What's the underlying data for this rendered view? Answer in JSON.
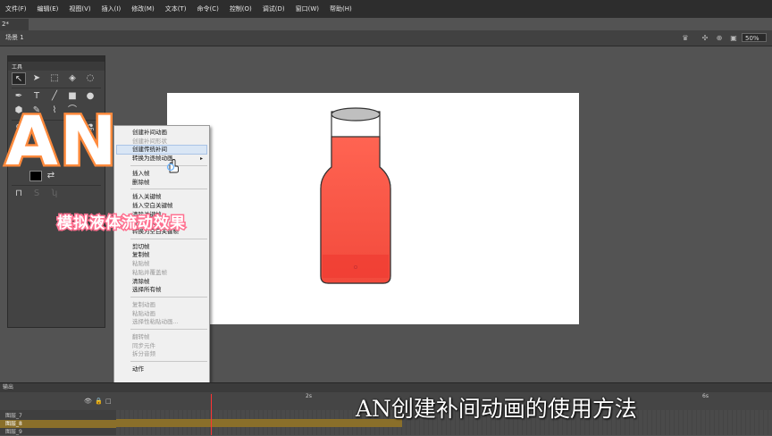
{
  "menubar": {
    "items": [
      "文件(F)",
      "编辑(E)",
      "视图(V)",
      "插入(I)",
      "修改(M)",
      "文本(T)",
      "命令(C)",
      "控制(O)",
      "调试(D)",
      "窗口(W)",
      "帮助(H)"
    ]
  },
  "document": {
    "tab_label": "2*"
  },
  "scene": {
    "label": "场景 1",
    "zoom": "50%"
  },
  "tools": {
    "title": "工具"
  },
  "context_menu": {
    "groups": [
      [
        {
          "label": "创建补间动画",
          "enabled": true
        },
        {
          "label": "创建补间形状",
          "enabled": false
        },
        {
          "label": "创建传统补间",
          "enabled": true
        },
        {
          "label": "转换为逐帧动画",
          "enabled": true,
          "submenu": true
        }
      ],
      [
        {
          "label": "插入帧",
          "enabled": true
        },
        {
          "label": "删除帧",
          "enabled": true
        }
      ],
      [
        {
          "label": "插入关键帧",
          "enabled": true
        },
        {
          "label": "插入空白关键帧",
          "enabled": true
        },
        {
          "label": "清除关键帧",
          "enabled": true
        },
        {
          "label": "转换为关键帧",
          "enabled": true
        },
        {
          "label": "转换为空白关键帧",
          "enabled": true
        }
      ],
      [
        {
          "label": "剪切帧",
          "enabled": true
        },
        {
          "label": "复制帧",
          "enabled": true
        },
        {
          "label": "粘贴帧",
          "enabled": false
        },
        {
          "label": "粘贴并覆盖帧",
          "enabled": false
        },
        {
          "label": "清除帧",
          "enabled": true
        },
        {
          "label": "选择所有帧",
          "enabled": true
        }
      ],
      [
        {
          "label": "复制动画",
          "enabled": false
        },
        {
          "label": "粘贴动画",
          "enabled": false
        },
        {
          "label": "选择性粘贴动画...",
          "enabled": false
        }
      ],
      [
        {
          "label": "翻转帧",
          "enabled": false
        },
        {
          "label": "同步元件",
          "enabled": false
        },
        {
          "label": "拆分音频",
          "enabled": false
        }
      ],
      [
        {
          "label": "动作",
          "enabled": true
        }
      ]
    ]
  },
  "timeline": {
    "tab": "输出",
    "seconds": [
      "2s",
      "6s"
    ],
    "layers": [
      "图层_7",
      "图层_8",
      "图层_9"
    ]
  },
  "overlay": {
    "logo": "AN",
    "subtitle": "模拟液体流动效果",
    "caption": "AN创建补间动画的使用方法"
  },
  "colors": {
    "liquid": "#ff5c4d",
    "logo_stroke": "#ff8a3c",
    "subtitle_stroke": "#ff6f8f",
    "frame_span": "#8a6f2a"
  }
}
